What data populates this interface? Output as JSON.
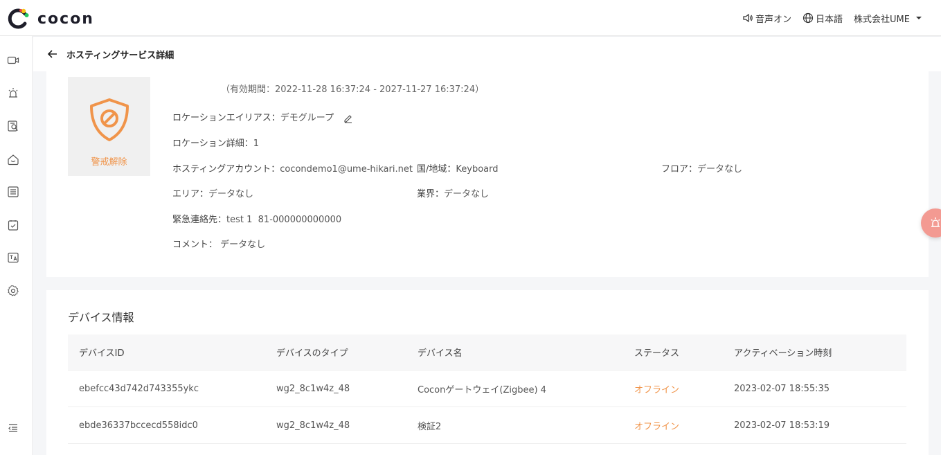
{
  "header": {
    "logo_text": "cocon",
    "sound_label": "音声オン",
    "language_label": "日本語",
    "company_label": "株式会社UME"
  },
  "page": {
    "title": "ホスティングサービス詳細"
  },
  "service": {
    "status_label": "警戒解除",
    "period_text": "（有効期間：2022-11-28 16:37:24 - 2027-11-27 16:37:24）",
    "location_alias_label": "ロケーションエイリアス：",
    "location_alias_value": "デモグループ",
    "location_detail_label": "ロケーション詳細：",
    "location_detail_value": "1",
    "hosting_account_label": "ホスティングアカウント：",
    "hosting_account_value": "cocondemo1@ume-hikari.net",
    "country_label": "国/地域：",
    "country_value": "Keyboard",
    "floor_label": "フロア：",
    "floor_value": "データなし",
    "area_label": "エリア：",
    "area_value": "データなし",
    "industry_label": "業界：",
    "industry_value": "データなし",
    "emergency_label": "緊急連絡先：",
    "emergency_value": "test 1  81-000000000000",
    "comment_label": "コメント：",
    "comment_value": "データなし"
  },
  "devices": {
    "title": "デバイス情報",
    "columns": [
      "デバイスID",
      "デバイスのタイプ",
      "デバイス名",
      "ステータス",
      "アクティベーション時刻"
    ],
    "rows": [
      {
        "id": "ebefcc43d742d743355ykc",
        "type": "wg2_8c1w4z_48",
        "name": "Coconゲートウェイ(Zigbee) 4",
        "status": "オフライン",
        "time": "2023-02-07 18:55:35"
      },
      {
        "id": "ebde36337bccecd558idc0",
        "type": "wg2_8c1w4z_48",
        "name": "検証2",
        "status": "オフライン",
        "time": "2023-02-07 18:53:19"
      }
    ]
  },
  "colors": {
    "accent_orange": "#f0944a",
    "alert_fab": "#f39a92"
  },
  "icons": {
    "sidebar": [
      "video-camera-icon",
      "alarm-light-icon",
      "search-document-icon",
      "home-icon",
      "list-icon",
      "clipboard-check-icon",
      "translate-icon",
      "settings-icon",
      "collapse-menu-icon"
    ]
  }
}
